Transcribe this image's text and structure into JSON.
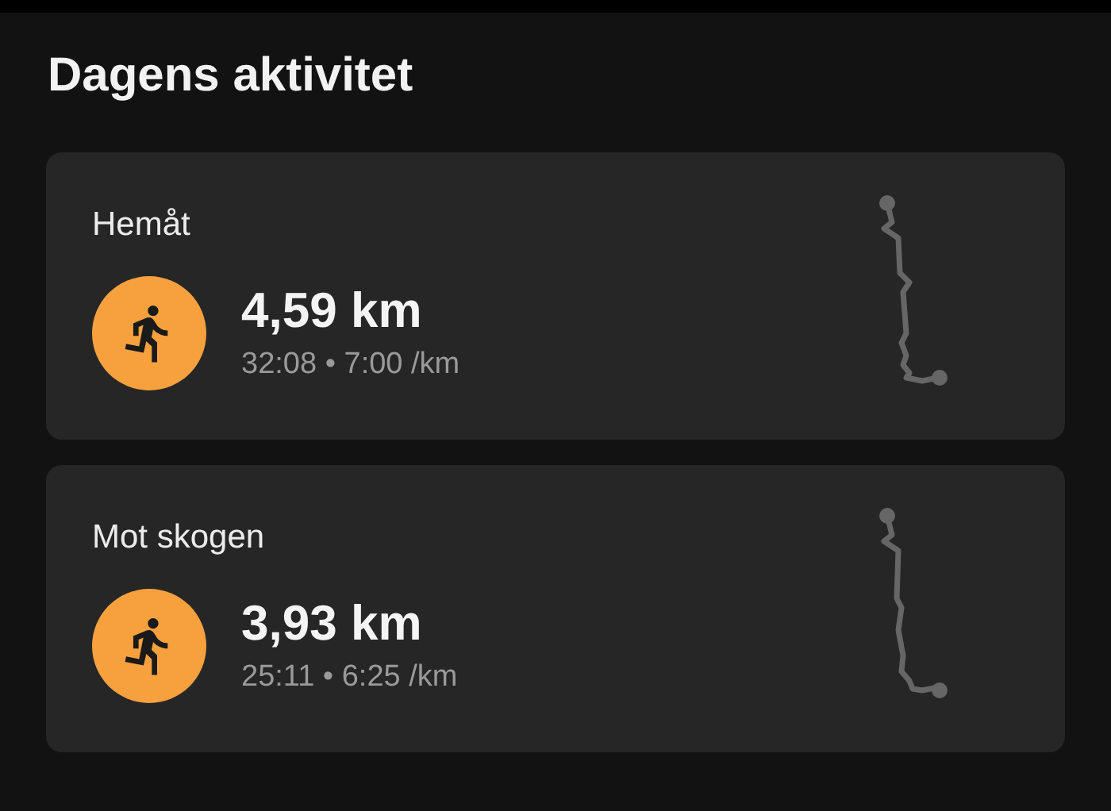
{
  "title": "Dagens aktivitet",
  "activities": [
    {
      "name": "Hemåt",
      "kind": "run",
      "distance": "4,59 km",
      "duration": "32:08",
      "separator": "•",
      "pace": "7:00 /km"
    },
    {
      "name": "Mot skogen",
      "kind": "run",
      "distance": "3,93 km",
      "duration": "25:11",
      "separator": "•",
      "pace": "6:25 /km"
    }
  ]
}
